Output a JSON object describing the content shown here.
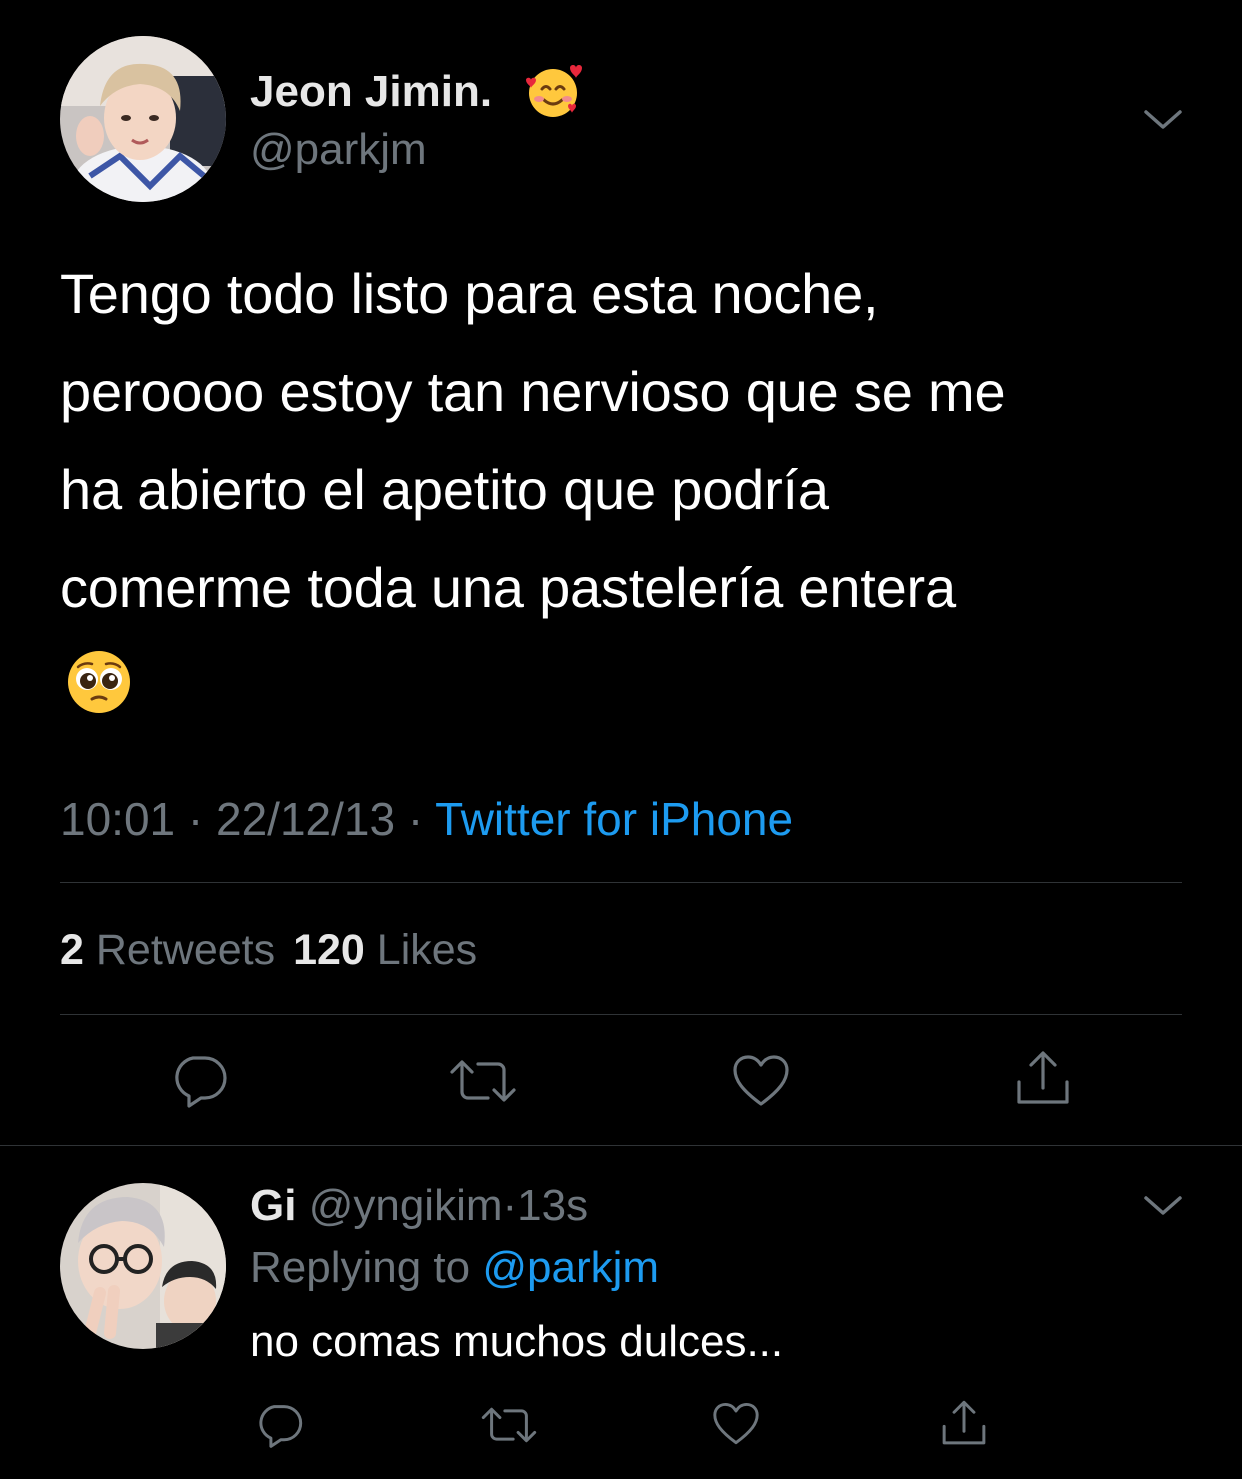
{
  "tweet": {
    "author_name": "Jeon Jimin.",
    "author_emoji_icon": "smiling-face-with-hearts-icon",
    "author_handle": "@parkjm",
    "text_lines": [
      "Tengo todo listo para esta noche,",
      "peroooo estoy tan nervioso que se me",
      "ha abierto el apetito que podría",
      "comerme toda una pastelería entera"
    ],
    "text_emoji_icon": "pleading-face-icon",
    "time": "10:01",
    "date": "22/12/13",
    "separator": "·",
    "source": "Twitter for iPhone",
    "retweets_count": "2",
    "retweets_label": "Retweets",
    "likes_count": "120",
    "likes_label": "Likes"
  },
  "reply": {
    "author_name": "Gi",
    "author_handle": "@yngikim",
    "separator": "·",
    "time_ago": "13s",
    "replying_to_label": "Replying to",
    "replying_to_handle": "@parkjm",
    "text": "no comas muchos dulces..."
  },
  "colors": {
    "background": "#000000",
    "text": "#ffffff",
    "muted": "#6e767d",
    "link": "#1d9bf0",
    "divider": "#2f3336"
  }
}
